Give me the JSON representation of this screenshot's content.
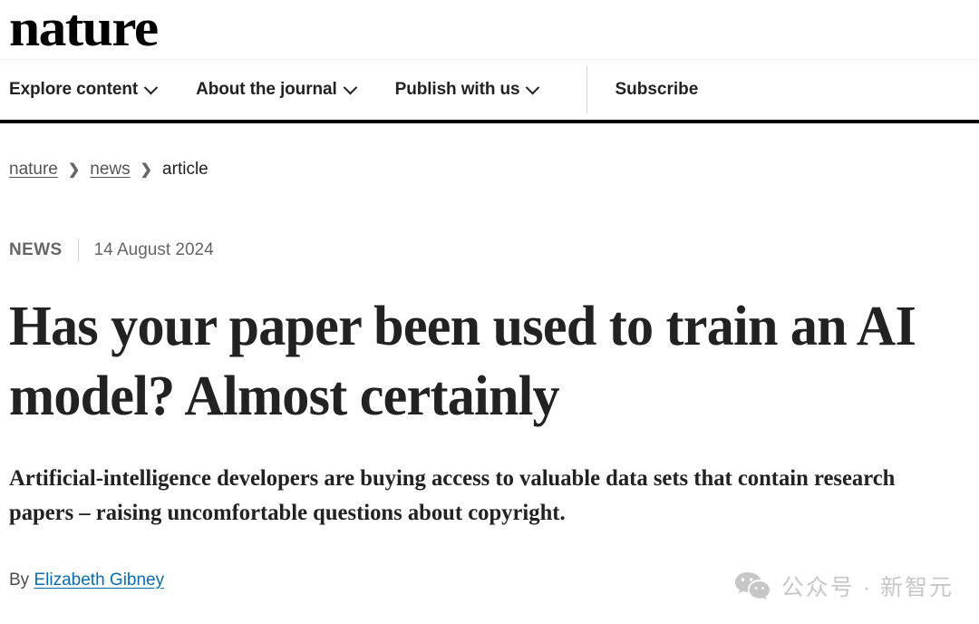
{
  "site": {
    "logo_text": "nature"
  },
  "nav": {
    "items": [
      {
        "label": "Explore content",
        "has_dropdown": true
      },
      {
        "label": "About the journal",
        "has_dropdown": true
      },
      {
        "label": "Publish with us",
        "has_dropdown": true
      }
    ],
    "subscribe_label": "Subscribe"
  },
  "breadcrumb": {
    "items": [
      {
        "label": "nature",
        "is_link": true
      },
      {
        "label": "news",
        "is_link": true
      },
      {
        "label": "article",
        "is_link": false
      }
    ],
    "separator": "›"
  },
  "article": {
    "kicker": "NEWS",
    "date": "14 August 2024",
    "headline": "Has your paper been used to train an AI model? Almost certainly",
    "standfirst": "Artificial-intelligence developers are buying access to valuable data sets that contain research papers – raising uncomfortable questions about copyright.",
    "byline_prefix": "By",
    "byline_author": "Elizabeth Gibney"
  },
  "watermark": {
    "icon": "wechat-icon",
    "text": "公众号 · 新智元"
  },
  "colors": {
    "link_blue": "#0a6cb0",
    "text_primary": "#222222",
    "text_muted": "#666666",
    "rule_black": "#000000",
    "watermark_gray": "#c7c7c7"
  }
}
